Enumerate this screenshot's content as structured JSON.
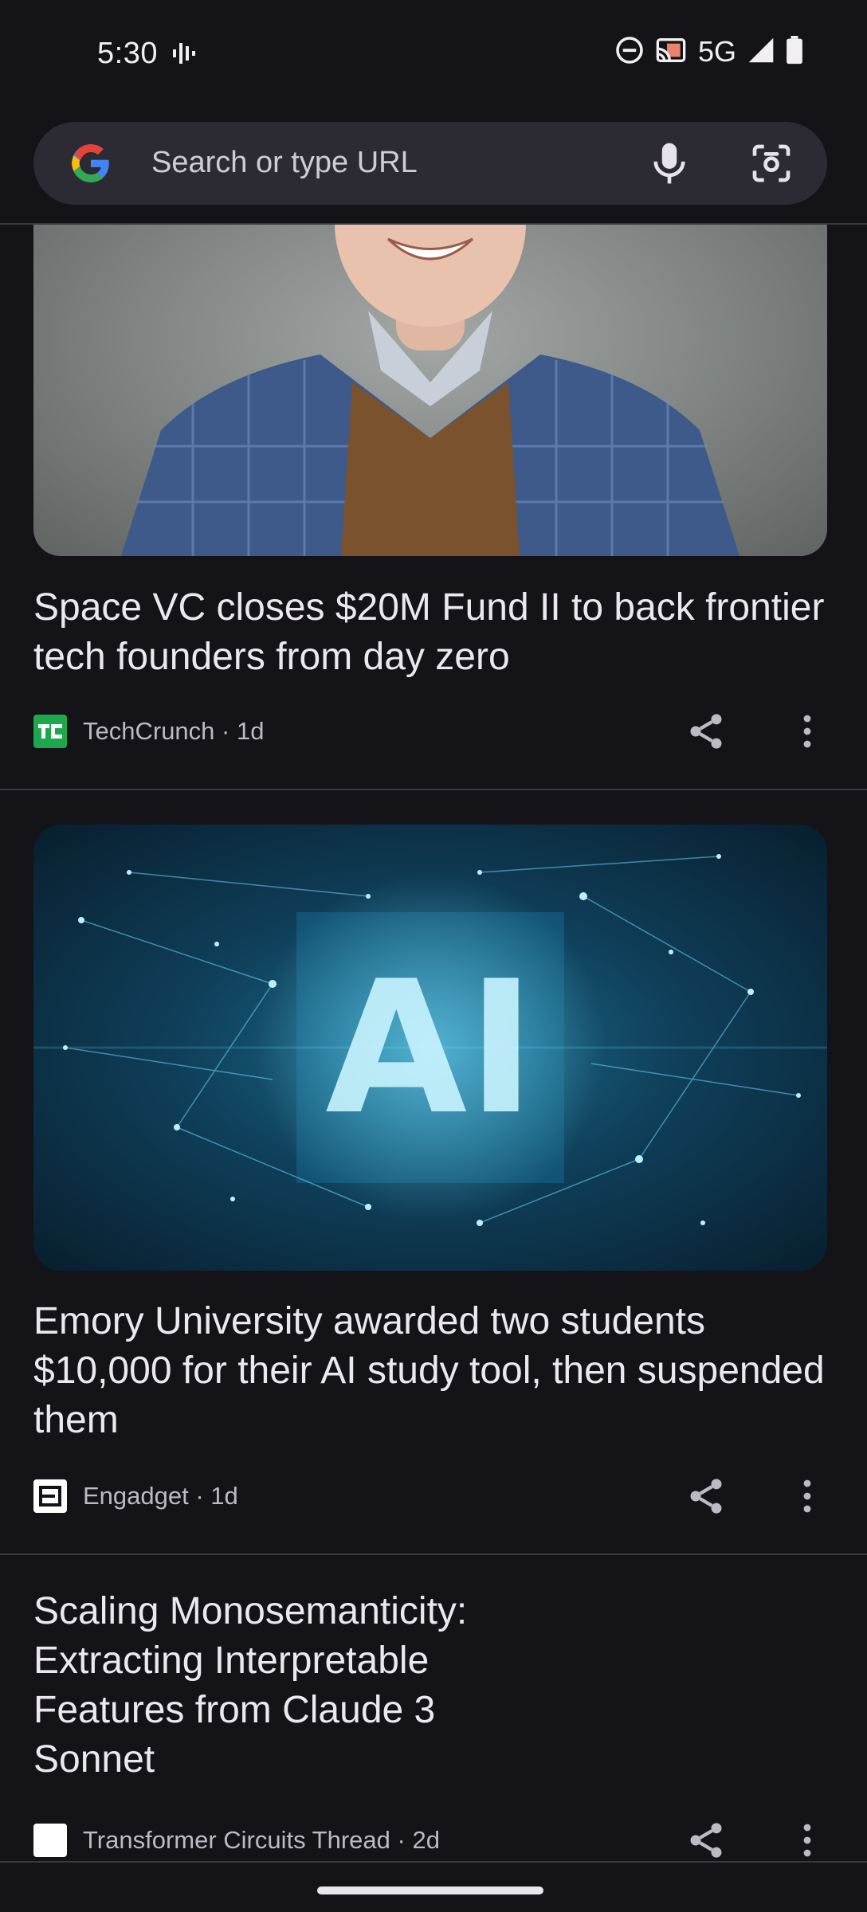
{
  "status_bar": {
    "time": "5:30",
    "network": "5G"
  },
  "search": {
    "placeholder": "Search or type URL"
  },
  "feed": {
    "cards": [
      {
        "title": "Space VC closes $20M Fund II to back frontier tech founders from day zero",
        "source": "TechCrunch",
        "age": "1d",
        "source_icon_text": "TC",
        "source_icon_color": "#1da84e"
      },
      {
        "title": "Emory University awarded two students $10,000 for their AI study tool, then suspended them",
        "source": "Engadget",
        "age": "1d",
        "image_text": "AI",
        "source_icon_color": "#ffffff"
      },
      {
        "title": "Scaling Monosemanticity: Extracting Interpretable Features from Claude 3 Sonnet",
        "source": "Transformer Circuits Thread",
        "age": "2d",
        "source_icon_color": "#ffffff"
      }
    ]
  },
  "colors": {
    "background": "#131318",
    "search_bar": "#2c2b34",
    "divider": "#3a3940",
    "text_primary": "#ebe8ef",
    "text_secondary": "#bdbac3"
  }
}
